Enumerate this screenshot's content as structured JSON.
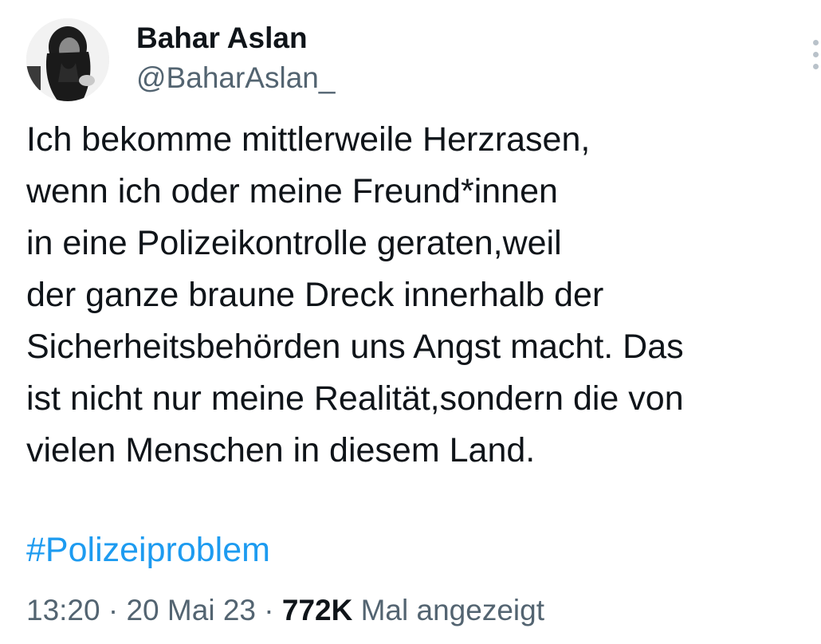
{
  "author": {
    "display_name": "Bahar Aslan",
    "handle": "@BaharAslan_"
  },
  "tweet": {
    "lines": [
      "Ich bekomme mittlerweile Herzrasen,",
      "wenn ich oder meine Freund*innen",
      "in eine Polizeikontrolle geraten,weil",
      "der ganze braune Dreck innerhalb der",
      "Sicherheitsbehörden uns Angst macht. Das",
      "ist nicht nur meine Realität,sondern die von",
      "vielen Menschen in diesem Land."
    ],
    "hashtag": "#Polizeiproblem"
  },
  "meta": {
    "time": "13:20",
    "separator": "·",
    "date": "20 Mai 23",
    "views_count": "772K",
    "views_label": "Mal angezeigt"
  },
  "icons": {
    "more": "more-vertical-icon"
  },
  "colors": {
    "text": "#0f1419",
    "secondary": "#536471",
    "link": "#1d9bf0"
  }
}
